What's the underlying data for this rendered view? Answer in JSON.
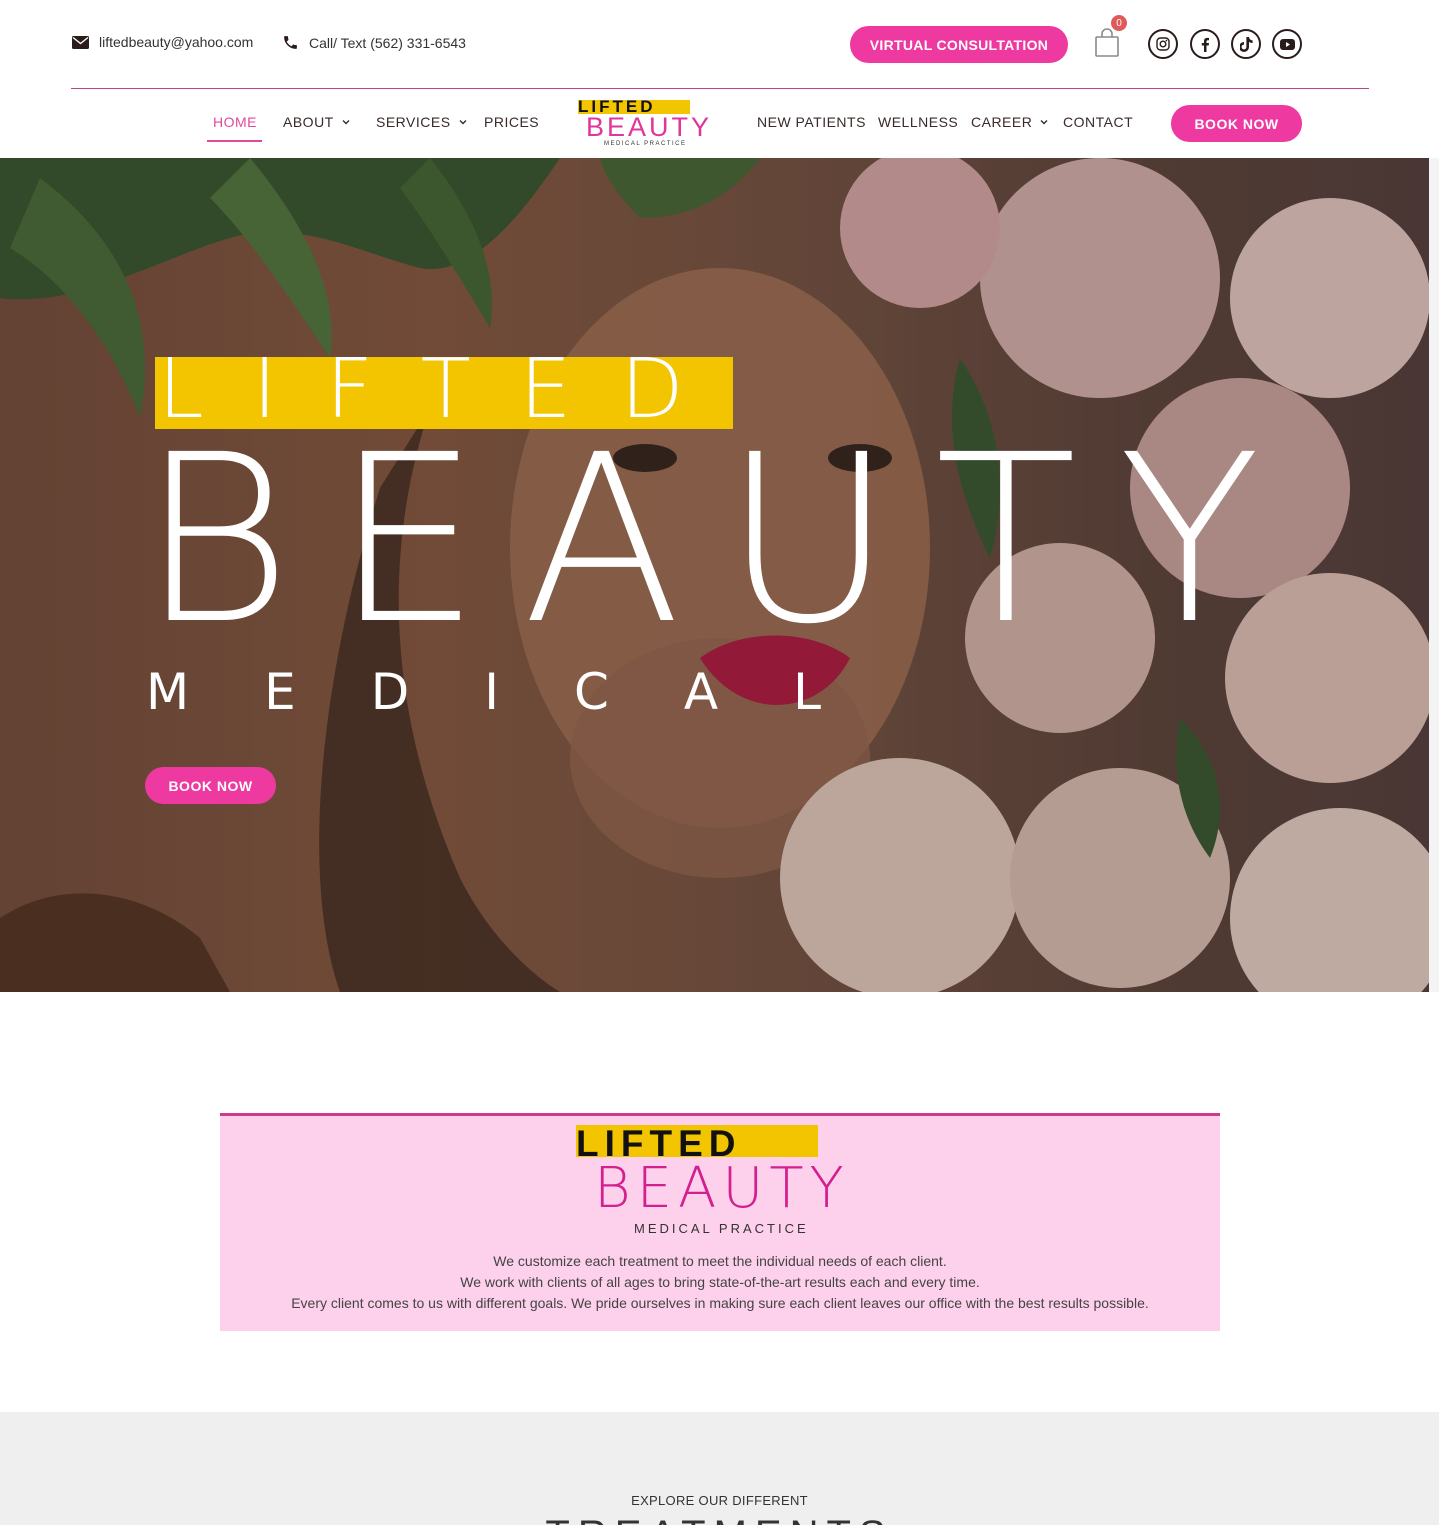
{
  "header": {
    "email": "liftedbeauty@yahoo.com",
    "phone": "Call/ Text (562) 331-6543",
    "consultation_label": "VIRTUAL CONSULTATION",
    "cart_count": "0",
    "social_icons": [
      "instagram-icon",
      "facebook-icon",
      "tiktok-icon",
      "youtube-icon"
    ]
  },
  "nav": {
    "items": [
      {
        "label": "HOME",
        "active": true
      },
      {
        "label": "ABOUT",
        "dropdown": true
      },
      {
        "label": "SERVICES",
        "dropdown": true
      },
      {
        "label": "PRICES"
      },
      {
        "label": "NEW PATIENTS"
      },
      {
        "label": "WELLNESS"
      },
      {
        "label": "CAREER",
        "dropdown": true
      },
      {
        "label": "CONTACT"
      }
    ],
    "book_label": "BOOK NOW"
  },
  "logo": {
    "lifted": "LIFTED",
    "beauty": "BEAUTY",
    "tagline": "MEDICAL PRACTICE"
  },
  "hero": {
    "lifted": "LIFTED",
    "beauty": "BEAUTY",
    "medical": "MEDICAL",
    "book_label": "BOOK NOW"
  },
  "intro": {
    "lines": [
      "We customize each treatment to meet the individual needs of each client.",
      "We work with clients of all ages to bring state-of-the-art results each and every time.",
      "Every client comes to us with different goals. We pride ourselves in making sure each client leaves our office with the best results possible."
    ]
  },
  "treatments": {
    "subtitle": "EXPLORE OUR DIFFERENT",
    "title": "TREATMENTS"
  },
  "colors": {
    "accent_pink": "#ee3aa0",
    "logo_yellow": "#f2c500",
    "intro_bg": "#fdd0ec"
  }
}
